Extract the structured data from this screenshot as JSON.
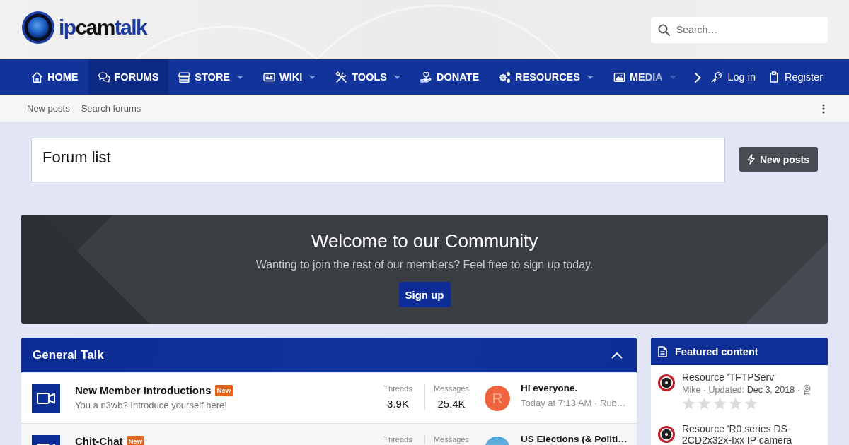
{
  "header": {
    "logo": [
      {
        "text": "ip",
        "accent": true
      },
      {
        "text": "cam",
        "accent": false
      },
      {
        "text": "talk",
        "accent": true
      }
    ],
    "search": {
      "placeholder": "Search…"
    }
  },
  "nav": {
    "items": [
      {
        "label": "HOME",
        "selected": false,
        "dropdown": false
      },
      {
        "label": "FORUMS",
        "selected": true,
        "dropdown": false
      },
      {
        "label": "STORE",
        "selected": false,
        "dropdown": true
      },
      {
        "label": "WIKI",
        "selected": false,
        "dropdown": true
      },
      {
        "label": "TOOLS",
        "selected": false,
        "dropdown": true
      },
      {
        "label": "DONATE",
        "selected": false,
        "dropdown": false
      },
      {
        "label": "RESOURCES",
        "selected": false,
        "dropdown": true
      },
      {
        "label": "MEDIA",
        "selected": false,
        "dropdown": true
      }
    ],
    "account_links": [
      {
        "label": "Log in"
      },
      {
        "label": "Register"
      }
    ]
  },
  "sub_nav": {
    "links": [
      "New posts",
      "Search forums"
    ]
  },
  "page_title": "Forum list",
  "new_posts_button": "New posts",
  "welcome": {
    "title": "Welcome to our Community",
    "text": "Wanting to join the rest of our members? Feel free to sign up today.",
    "button": "Sign up"
  },
  "category": {
    "title": "General Talk",
    "expanded": true,
    "forums": [
      {
        "title": "New Member Introductions",
        "badge": "New",
        "description": "You a n3wb? Introduce yourself here!",
        "stats": [
          {
            "label": "Threads",
            "value": "3.9K"
          },
          {
            "label": "Messages",
            "value": "25.4K"
          }
        ],
        "avatar": {
          "kind": "letter",
          "letter": "R",
          "color": "#f0643f"
        },
        "latest": {
          "title": "Hi everyone.",
          "meta": "Today at 7:13 AM · Rub…"
        }
      },
      {
        "title": "Chit-Chat",
        "badge": "New",
        "stats": [
          {
            "label": "Threads"
          },
          {
            "label": "Messages"
          }
        ],
        "avatar": {
          "kind": "photo"
        },
        "latest": {
          "title": "US Elections (& Politi…"
        }
      }
    ]
  },
  "featured": {
    "title": "Featured content",
    "items": [
      {
        "title": "Resource 'TFTPServ'",
        "meta": "Mike · Updated:",
        "date": "Dec 3, 2018",
        "meta_end": "·",
        "stars": 0
      },
      {
        "title": "Resource 'R0 series DS-2CD2x32x-Ixx IP camera"
      }
    ]
  }
}
